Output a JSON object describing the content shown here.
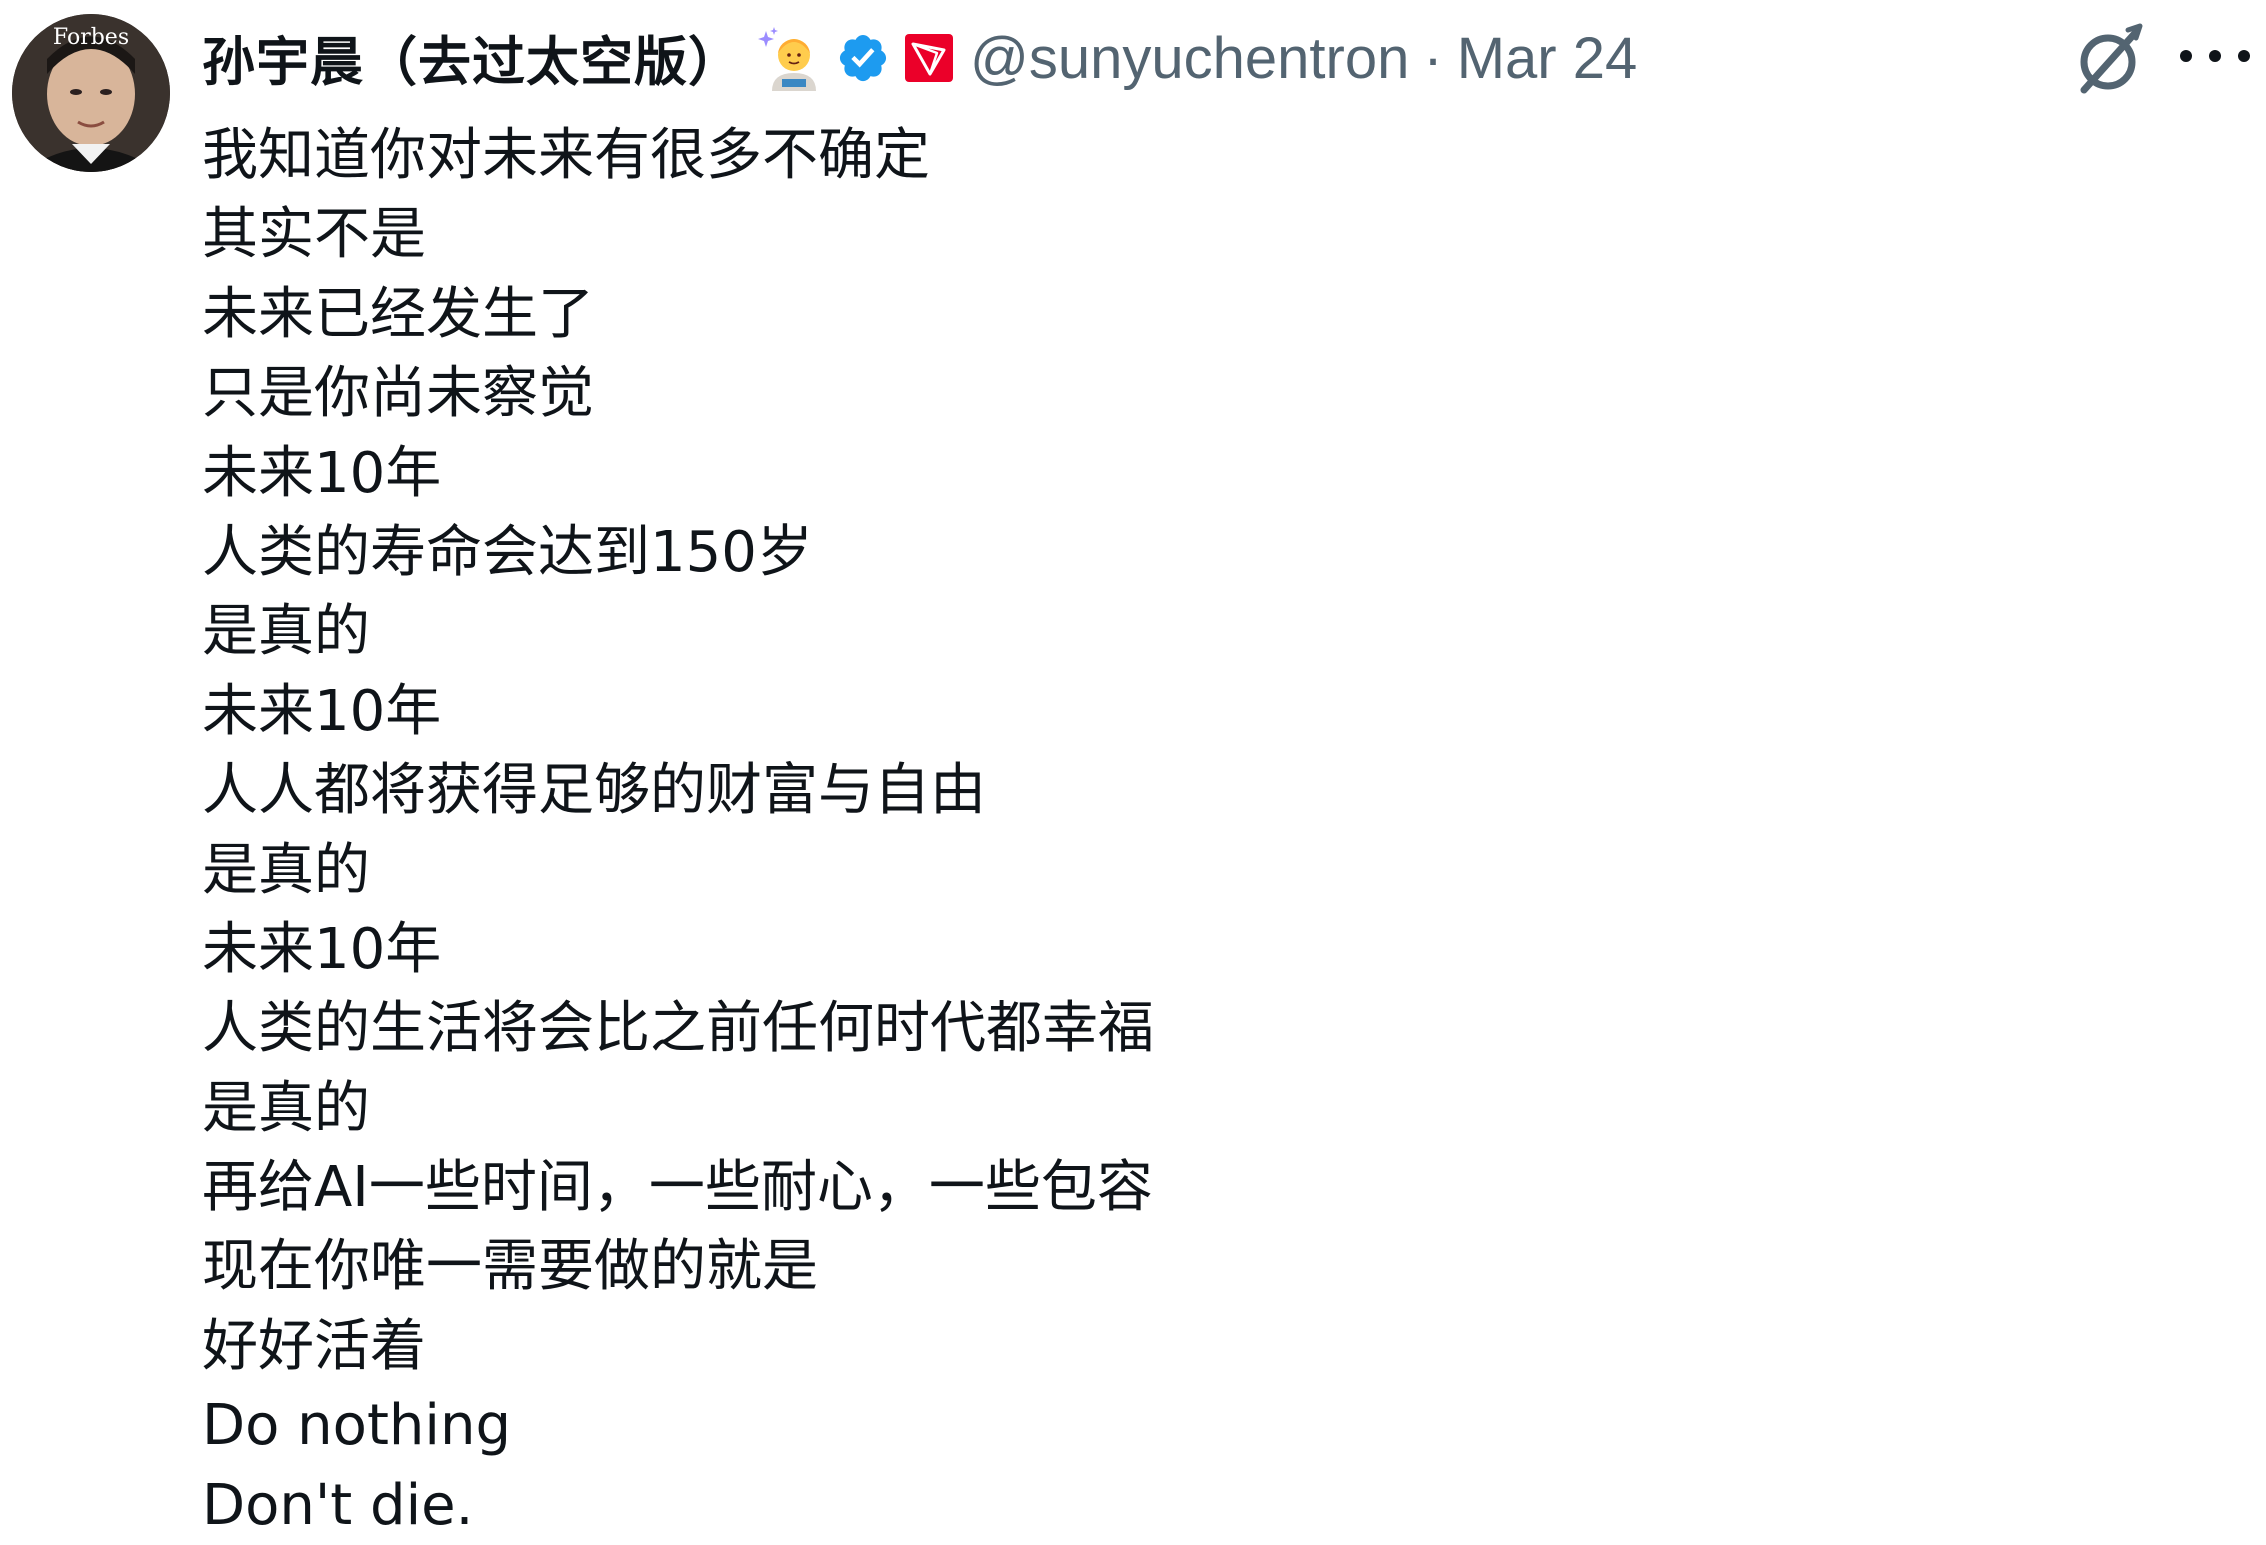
{
  "tweet": {
    "display_name": "孙宇晨（去过太空版）",
    "handle": "@sunyuchentron",
    "separator": "·",
    "date": "Mar 24",
    "avatar_text": "Forbes",
    "icons": {
      "emoji": "astronaut-emoji-icon",
      "verified": "verified-badge-icon",
      "affiliate": "tron-logo-icon",
      "grok": "grok-icon",
      "more": "more-options-icon"
    },
    "colors": {
      "verified": "#1d9bf0",
      "tron": "#eb0029",
      "secondary_text": "#536471",
      "primary_text": "#0f1419"
    },
    "lines": [
      "我知道你对未来有很多不确定",
      "其实不是",
      "未来已经发生了",
      "只是你尚未察觉",
      "未来10年",
      "人类的寿命会达到150岁",
      "是真的",
      "未来10年",
      "人人都将获得足够的财富与自由",
      "是真的",
      "未来10年",
      "人类的生活将会比之前任何时代都幸福",
      "是真的",
      "再给AI一些时间，一些耐心，一些包容",
      "现在你唯一需要做的就是",
      "好好活着",
      "Do nothing",
      "Don't die."
    ]
  }
}
